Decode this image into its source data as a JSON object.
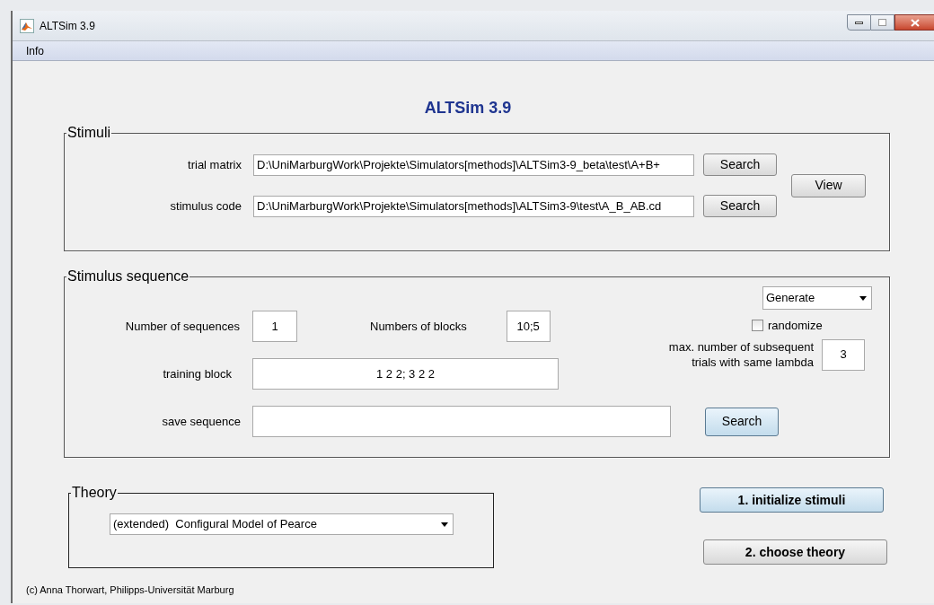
{
  "window": {
    "title": "ALTSim 3.9"
  },
  "menu": [
    {
      "label": "Info"
    }
  ],
  "app_title": "ALTSim 3.9",
  "stimuli": {
    "title": "Stimuli",
    "rows": [
      {
        "label": "trial matrix",
        "value": "D:\\UniMarburgWork\\Projekte\\Simulators[methods]\\ALTSim3-9_beta\\test\\A+B+",
        "button": "Search"
      },
      {
        "label": "stimulus code",
        "value": "D:\\UniMarburgWork\\Projekte\\Simulators[methods]\\ALTSim3-9\\test\\A_B_AB.cd",
        "button": "Search"
      }
    ],
    "view_button": "View"
  },
  "sequence": {
    "title": "Stimulus sequence",
    "number_of_sequences": {
      "label": "Number of sequences",
      "value": "1"
    },
    "number_of_blocks": {
      "label": "Numbers of blocks",
      "value": "10;5"
    },
    "training_block": {
      "label": "training block",
      "value": "1 2 2; 3 2 2"
    },
    "save_sequence": {
      "label": "save sequence",
      "button": {
        "label": "Search",
        "highlighted": true
      }
    },
    "mode_dropdown": {
      "value": "Generate"
    },
    "randomize": {
      "label": "randomize",
      "checked": false
    },
    "max_subsequent": {
      "label_lines": [
        "max. number of subsequent",
        "trials with same lambda"
      ],
      "value": "3"
    }
  },
  "theory": {
    "title": "Theory",
    "value": "(extended)  Configural Model of Pearce"
  },
  "actions": [
    {
      "label": "1. initialize stimuli",
      "highlighted": true
    },
    {
      "label": "2. choose theory",
      "highlighted": false
    }
  ],
  "footer": "(c) Anna Thorwart, Philipps-Universität Marburg"
}
